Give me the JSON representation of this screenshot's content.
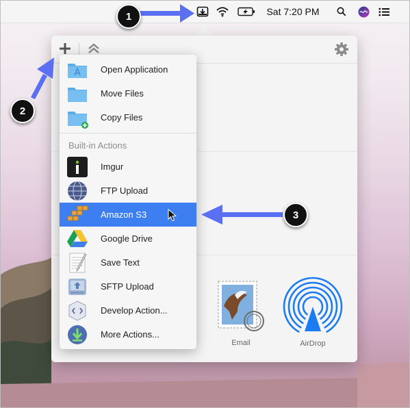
{
  "menubar": {
    "clock": "Sat 7:20 PM"
  },
  "callouts": [
    "1",
    "2",
    "3"
  ],
  "toolbar": {
    "add_icon": "plus-icon",
    "collapse_icon": "chevron-up-double-icon",
    "settings_icon": "gear-icon"
  },
  "menu": {
    "items": [
      {
        "label": "Open Application",
        "icon": "folder-app-icon"
      },
      {
        "label": "Move Files",
        "icon": "folder-icon"
      },
      {
        "label": "Copy Files",
        "icon": "folder-add-icon"
      }
    ],
    "section_label": "Built-in Actions",
    "actions": [
      {
        "label": "Imgur",
        "icon": "imgur-icon"
      },
      {
        "label": "FTP Upload",
        "icon": "globe-icon"
      },
      {
        "label": "Amazon S3",
        "icon": "amazon-s3-icon",
        "selected": true
      },
      {
        "label": "Google Drive",
        "icon": "google-drive-icon"
      },
      {
        "label": "Save Text",
        "icon": "text-edit-icon"
      },
      {
        "label": "SFTP Upload",
        "icon": "sftp-icon"
      },
      {
        "label": "Develop Action...",
        "icon": "develop-icon"
      },
      {
        "label": "More Actions...",
        "icon": "download-globe-icon"
      }
    ]
  },
  "share": {
    "email_label": "Email",
    "airdrop_label": "AirDrop"
  },
  "colors": {
    "selection": "#3d7ff1",
    "arrow": "#5b6ff3"
  }
}
